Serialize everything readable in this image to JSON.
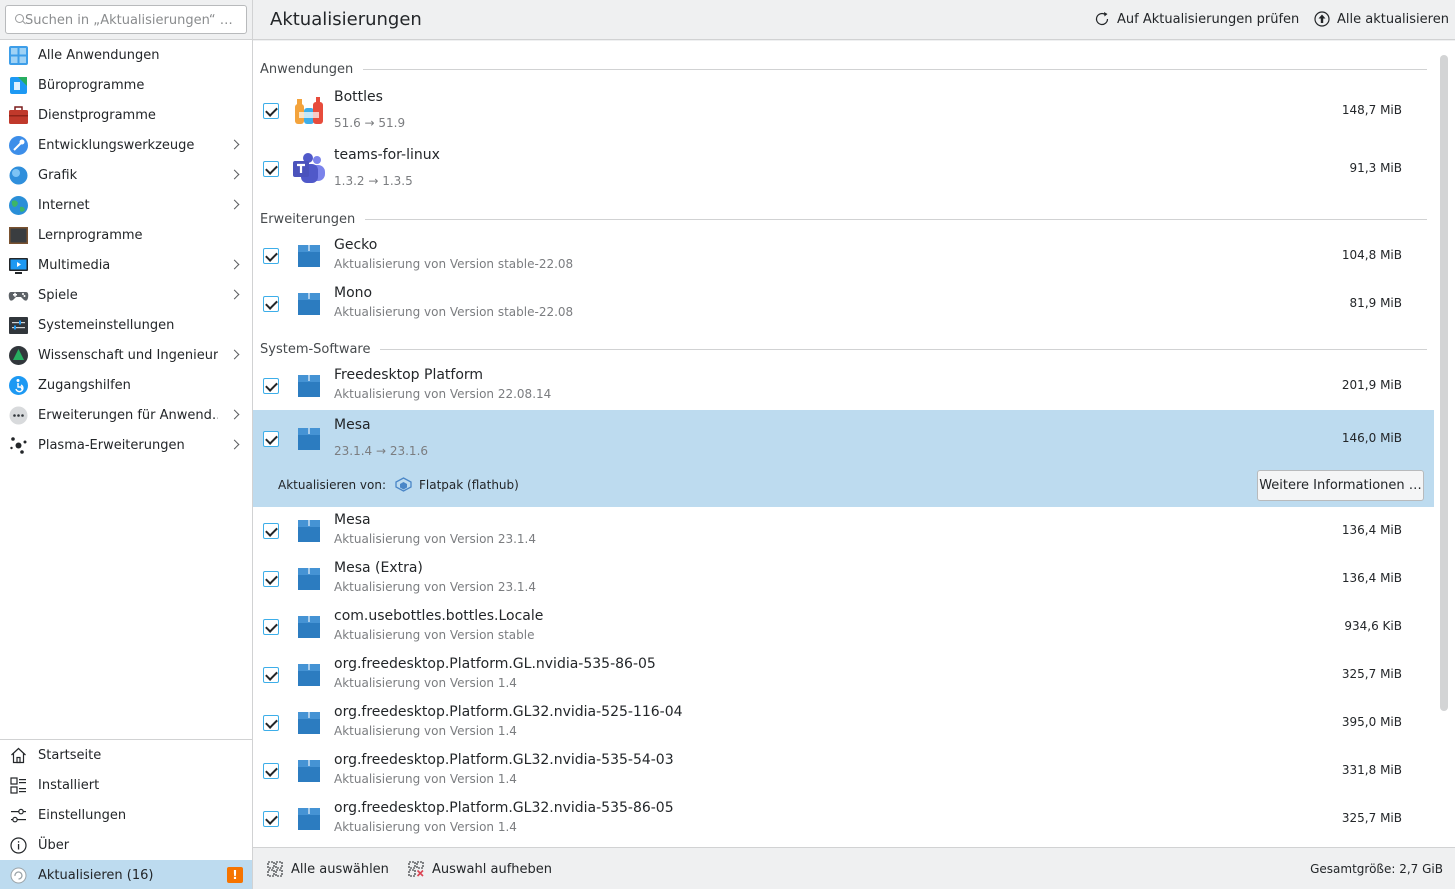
{
  "search": {
    "placeholder": "Suchen in „Aktualisierungen“ …"
  },
  "categories": [
    {
      "label": "Alle Anwendungen",
      "icon": "grid-icon",
      "submenu": false
    },
    {
      "label": "Büroprogramme",
      "icon": "office-icon",
      "submenu": false
    },
    {
      "label": "Dienstprogramme",
      "icon": "toolbox-icon",
      "submenu": false
    },
    {
      "label": "Entwicklungswerkzeuge",
      "icon": "development-icon",
      "submenu": true
    },
    {
      "label": "Grafik",
      "icon": "graphics-icon",
      "submenu": true
    },
    {
      "label": "Internet",
      "icon": "globe-icon",
      "submenu": true
    },
    {
      "label": "Lernprogramme",
      "icon": "chalkboard-icon",
      "submenu": false
    },
    {
      "label": "Multimedia",
      "icon": "multimedia-icon",
      "submenu": true
    },
    {
      "label": "Spiele",
      "icon": "gamepad-icon",
      "submenu": true
    },
    {
      "label": "Systemeinstellungen",
      "icon": "system-settings-icon",
      "submenu": false
    },
    {
      "label": "Wissenschaft und Ingenieur…",
      "icon": "science-icon",
      "submenu": true
    },
    {
      "label": "Zugangshilfen",
      "icon": "accessibility-icon",
      "submenu": false
    },
    {
      "label": "Erweiterungen für Anwend…",
      "icon": "extensions-icon",
      "submenu": true
    },
    {
      "label": "Plasma-Erweiterungen",
      "icon": "plasma-icon",
      "submenu": true
    }
  ],
  "nav": {
    "home": "Startseite",
    "installed": "Installiert",
    "settings": "Einstellungen",
    "about": "Über",
    "updates": "Aktualisieren (16)",
    "updates_badge": "!"
  },
  "header": {
    "title": "Aktualisierungen",
    "check_label": "Auf Aktualisierungen prüfen",
    "update_all_label": "Alle aktualisieren"
  },
  "sections": {
    "apps": "Anwendungen",
    "extensions": "Erweiterungen",
    "system": "System-Software"
  },
  "rows": {
    "bottles": {
      "name": "Bottles",
      "sub": "51.6 → 51.9",
      "size": "148,7 MiB"
    },
    "teams": {
      "name": "teams-for-linux",
      "sub": "1.3.2 → 1.3.5",
      "size": "91,3 MiB"
    },
    "gecko": {
      "name": "Gecko",
      "sub": "Aktualisierung von Version stable-22.08",
      "size": "104,8 MiB"
    },
    "mono": {
      "name": "Mono",
      "sub": "Aktualisierung von Version stable-22.08",
      "size": "81,9 MiB"
    },
    "freedesktop": {
      "name": "Freedesktop Platform",
      "sub": "Aktualisierung von Version 22.08.14",
      "size": "201,9 MiB"
    },
    "mesa_sel": {
      "name": "Mesa",
      "sub": "23.1.4 → 23.1.6",
      "size": "146,0 MiB"
    },
    "mesa": {
      "name": "Mesa",
      "sub": "Aktualisierung von Version 23.1.4",
      "size": "136,4 MiB"
    },
    "mesa_extra": {
      "name": "Mesa (Extra)",
      "sub": "Aktualisierung von Version 23.1.4",
      "size": "136,4 MiB"
    },
    "bottles_locale": {
      "name": "com.usebottles.bottles.Locale",
      "sub": "Aktualisierung von Version stable",
      "size": "934,6 KiB"
    },
    "gl_535_86": {
      "name": "org.freedesktop.Platform.GL.nvidia-535-86-05",
      "sub": "Aktualisierung von Version 1.4",
      "size": "325,7 MiB"
    },
    "gl32_525_116": {
      "name": "org.freedesktop.Platform.GL32.nvidia-525-116-04",
      "sub": "Aktualisierung von Version 1.4",
      "size": "395,0 MiB"
    },
    "gl32_535_54": {
      "name": "org.freedesktop.Platform.GL32.nvidia-535-54-03",
      "sub": "Aktualisierung von Version 1.4",
      "size": "331,8 MiB"
    },
    "gl32_535_86": {
      "name": "org.freedesktop.Platform.GL32.nvidia-535-86-05",
      "sub": "Aktualisierung von Version 1.4",
      "size": "325,7 MiB"
    }
  },
  "detail": {
    "source_label": "Aktualisieren von:",
    "source_value": "Flatpak (flathub)",
    "more_button": "Weitere Informationen …"
  },
  "footer": {
    "select_all": "Alle auswählen",
    "deselect": "Auswahl aufheben",
    "total": "Gesamtgröße: 2,7 GiB"
  },
  "colors": {
    "accent": "#3daee9",
    "selection": "#bddbef",
    "warning": "#f67400",
    "package_blue": "#2c7cc0"
  }
}
